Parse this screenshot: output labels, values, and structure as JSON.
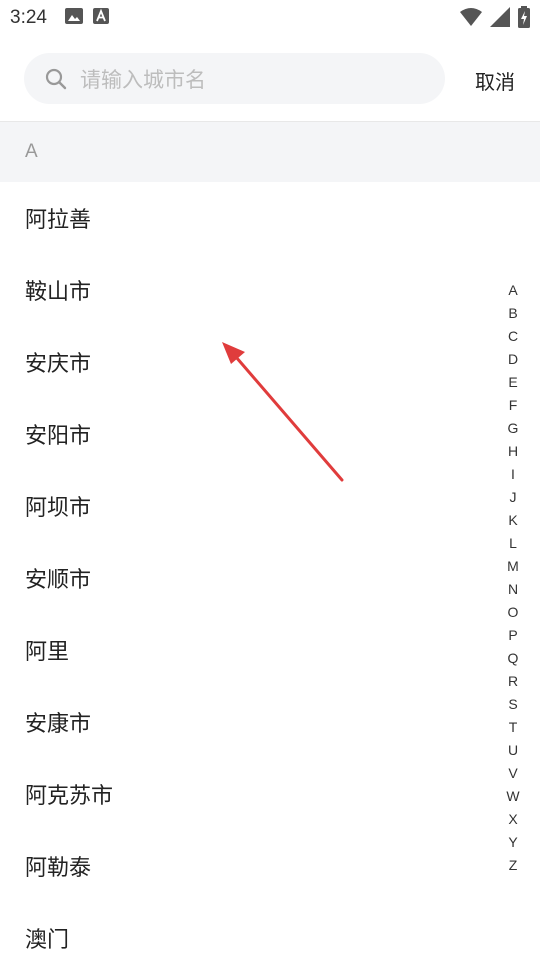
{
  "status_bar": {
    "time": "3:24",
    "left_icons": [
      "image-icon",
      "a-box-icon"
    ],
    "right_icons": [
      "wifi-icon",
      "signal-icon",
      "battery-icon"
    ]
  },
  "search": {
    "placeholder": "请输入城市名",
    "icon": "search-icon",
    "cancel_label": "取消"
  },
  "section": {
    "letter": "A"
  },
  "cities": [
    "阿拉善",
    "鞍山市",
    "安庆市",
    "安阳市",
    "阿坝市",
    "安顺市",
    "阿里",
    "安康市",
    "阿克苏市",
    "阿勒泰",
    "澳门"
  ],
  "index_letters": [
    "A",
    "B",
    "C",
    "D",
    "E",
    "F",
    "G",
    "H",
    "I",
    "J",
    "K",
    "L",
    "M",
    "N",
    "O",
    "P",
    "Q",
    "R",
    "S",
    "T",
    "U",
    "V",
    "W",
    "X",
    "Y",
    "Z"
  ],
  "colors": {
    "annotation_arrow": "#e03c3c",
    "search_bg": "#f4f5f7",
    "section_bg": "#f4f5f7"
  }
}
